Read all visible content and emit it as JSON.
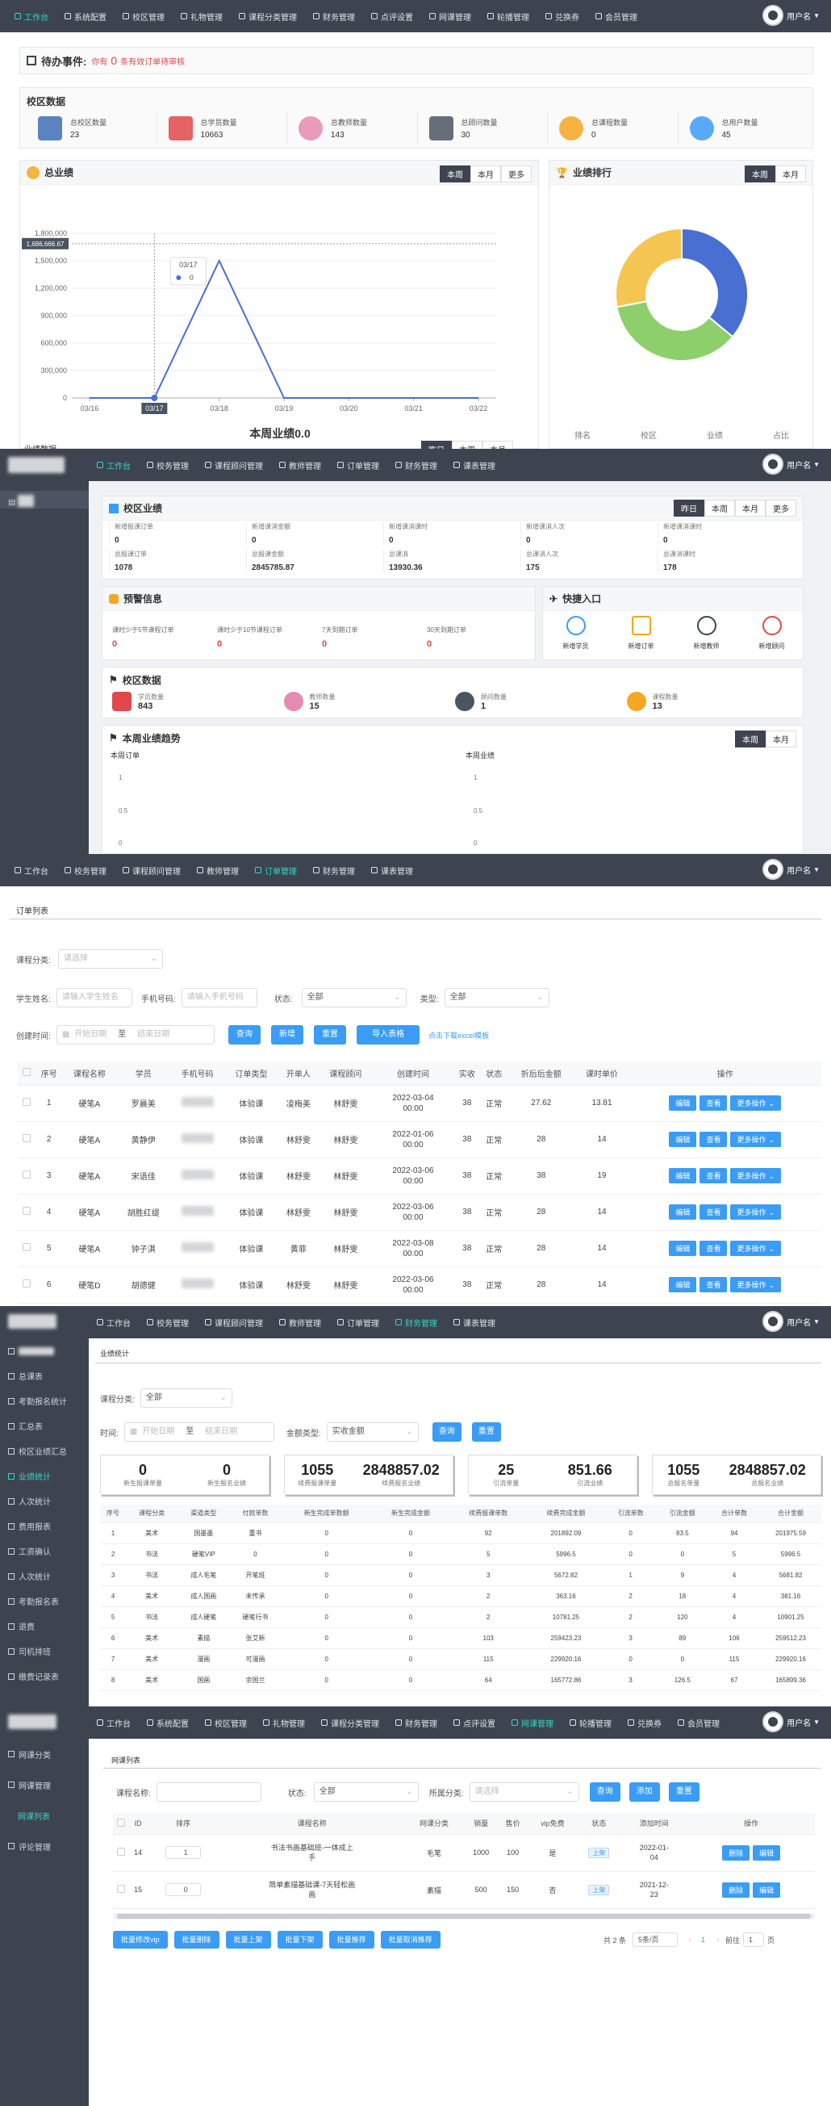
{
  "nav1": {
    "items": [
      "工作台",
      "系统配置",
      "校区管理",
      "礼物管理",
      "课程分类管理",
      "财务管理",
      "点评设置",
      "网课管理",
      "轮播管理",
      "兑换券",
      "会员管理"
    ],
    "active": 0,
    "user": "用户名"
  },
  "panel1": {
    "todo": {
      "title": "待办事件:",
      "prefix": "你有",
      "count": "0",
      "suffix": "条有效订单待审核"
    },
    "campus": {
      "title": "校区数据",
      "stats": [
        {
          "label": "总校区数量",
          "value": "23"
        },
        {
          "label": "总学员数量",
          "value": "10663"
        },
        {
          "label": "总教师数量",
          "value": "143"
        },
        {
          "label": "总顾问数量",
          "value": "30"
        },
        {
          "label": "总课程数量",
          "value": "0"
        },
        {
          "label": "总用户数量",
          "value": "45"
        }
      ]
    },
    "perf": {
      "title": "总业绩",
      "tabs": [
        "本周",
        "本月",
        "更多"
      ],
      "active": 0,
      "bottom_title": "本周业绩0.0",
      "tooltip_date": "03/17",
      "tooltip_value": "0",
      "hover_label": "1,686,666.67",
      "footer_left": "业绩数据",
      "footer_tabs": [
        "昨日",
        "本周",
        "本月"
      ]
    },
    "rank": {
      "title": "业绩排行",
      "tabs": [
        "本周",
        "本月"
      ],
      "active": 0,
      "cols": [
        "排名",
        "校区",
        "业绩",
        "占比"
      ]
    }
  },
  "chart_data": [
    {
      "type": "line",
      "title": "",
      "x": [
        "03/16",
        "03/17",
        "03/18",
        "03/19",
        "03/20",
        "03/21",
        "03/22"
      ],
      "values": [
        0,
        0,
        1500000,
        0,
        0,
        0,
        0
      ],
      "ylim": [
        0,
        1800000
      ],
      "yticks": [
        "0",
        "300,000",
        "600,000",
        "900,000",
        "1,200,000",
        "1,500,000",
        "1,800,000"
      ],
      "color": "#4a6fd2"
    },
    {
      "type": "pie",
      "values": [
        36,
        36,
        28
      ],
      "colors": [
        "#4a6fd2",
        "#8dd06b",
        "#f5c552"
      ]
    }
  ],
  "nav2": {
    "items": [
      "工作台",
      "校务管理",
      "课程顾问管理",
      "教师管理",
      "订单管理",
      "财务管理",
      "课表管理"
    ],
    "active": 0,
    "user": "用户名"
  },
  "panel2": {
    "side_item": "学生",
    "campus_perf": {
      "title": "校区业绩",
      "tabs": [
        "昨日",
        "本周",
        "本月",
        "更多"
      ],
      "active": 0,
      "row1": [
        {
          "label": "新增报课订单",
          "value": "0"
        },
        {
          "label": "新增课消金额",
          "value": "0"
        },
        {
          "label": "新增课消课时",
          "value": "0"
        },
        {
          "label": "新增课消人次",
          "value": "0"
        },
        {
          "label": "新增课消课时",
          "value": "0"
        }
      ],
      "row2": [
        {
          "label": "总报课订单",
          "value": "1078"
        },
        {
          "label": "总报课金额",
          "value": "2845785.87"
        },
        {
          "label": "总课消",
          "value": "13930.36"
        },
        {
          "label": "总课消人次",
          "value": "175"
        },
        {
          "label": "总课消课时",
          "value": "178"
        }
      ]
    },
    "warn": {
      "title": "预警信息",
      "items": [
        {
          "label": "课时少于5节课程订单",
          "value": "0"
        },
        {
          "label": "课时少于10节课程订单",
          "value": "0"
        },
        {
          "label": "7天到期订单",
          "value": "0"
        },
        {
          "label": "30天到期订单",
          "value": "0"
        }
      ]
    },
    "quick": {
      "title": "快捷入口",
      "items": [
        "新增学员",
        "新增订单",
        "新增教师",
        "新增顾问"
      ]
    },
    "cdata": {
      "title": "校区数据",
      "items": [
        {
          "label": "学员数量",
          "value": "843"
        },
        {
          "label": "教师数量",
          "value": "15"
        },
        {
          "label": "顾问数量",
          "value": "1"
        },
        {
          "label": "课程数量",
          "value": "13"
        }
      ]
    },
    "trend": {
      "title": "本周业绩趋势",
      "tabs": [
        "本周",
        "本月"
      ],
      "left": "本周订单",
      "right": "本周业绩",
      "ticks": [
        "1",
        "0.5",
        "0"
      ]
    }
  },
  "nav3": {
    "items": [
      "工作台",
      "校务管理",
      "课程顾问管理",
      "教师管理",
      "订单管理",
      "财务管理",
      "课表管理"
    ],
    "active": 4,
    "user": "用户名"
  },
  "panel3": {
    "title": "订单列表",
    "filters": {
      "category_label": "课程分类:",
      "category_ph": "请选择",
      "name_label": "学生姓名:",
      "name_ph": "请输入学生姓名",
      "phone_label": "手机号码:",
      "phone_ph": "请输入手机号码",
      "status_label": "状态:",
      "status_val": "全部",
      "type_label": "类型:",
      "type_val": "全部",
      "time_label": "创建时间:",
      "start_ph": "开始日期",
      "to": "至",
      "end_ph": "结束日期"
    },
    "buttons": {
      "query": "查询",
      "add": "新增",
      "reset": "重置",
      "import": "导入表格",
      "download": "点击下载excel模板"
    },
    "cols": [
      "序号",
      "课程名称",
      "学员",
      "手机号码",
      "订单类型",
      "开单人",
      "课程顾问",
      "创建时间",
      "实收",
      "状态",
      "折后后金额",
      "课时单价",
      "操作"
    ],
    "rows": [
      [
        "1",
        "硬笔A",
        "罗晨美",
        "",
        "体验课",
        "凌梅美",
        "林舒雯",
        "2022-03-04 00:00",
        "38",
        "正常",
        "27.62",
        "13.81"
      ],
      [
        "2",
        "硬笔A",
        "黄静伊",
        "",
        "体验课",
        "林舒雯",
        "林舒雯",
        "2022-01-06 00:00",
        "38",
        "正常",
        "28",
        "14"
      ],
      [
        "3",
        "硬笔A",
        "宋语佳",
        "",
        "体验课",
        "林舒雯",
        "林舒雯",
        "2022-03-06 00:00",
        "38",
        "正常",
        "38",
        "19"
      ],
      [
        "4",
        "硬笔A",
        "胡胜红缇",
        "",
        "体验课",
        "林舒雯",
        "林舒雯",
        "2022-03-06 00:00",
        "38",
        "正常",
        "28",
        "14"
      ],
      [
        "5",
        "硬笔A",
        "钟子淇",
        "",
        "体验课",
        "黄菲",
        "林舒雯",
        "2022-03-08 00:00",
        "38",
        "正常",
        "28",
        "14"
      ],
      [
        "6",
        "硬笔D",
        "胡德健",
        "",
        "体验课",
        "林舒雯",
        "林舒雯",
        "2022-03-06 00:00",
        "38",
        "正常",
        "28",
        "14"
      ]
    ],
    "ops": [
      "编辑",
      "查看",
      "更多操作"
    ]
  },
  "nav4": {
    "items": [
      "工作台",
      "校务管理",
      "课程顾问管理",
      "教师管理",
      "订单管理",
      "财务管理",
      "课表管理"
    ],
    "active": 5,
    "user": "用户名"
  },
  "panel4": {
    "side": [
      "",
      "总课表",
      "考勤报名统计",
      "汇总表",
      "校区业绩汇总",
      "",
      "人次统计",
      "费用报表",
      "工资确认",
      "人次统计",
      "考勤报名表",
      "退费",
      "司机排班",
      "缴费记录表"
    ],
    "side_active": 5,
    "side_active_label": "业绩统计",
    "title": "业绩统计",
    "filters": {
      "category_label": "课程分类:",
      "category_val": "全部",
      "time_label": "时间:",
      "start_ph": "开始日期",
      "to": "至",
      "end_ph": "结束日期",
      "type_label": "金额类型:",
      "type_val": "实收金额",
      "query": "查询",
      "reset": "重置"
    },
    "summary": [
      {
        "v1": "0",
        "l1": "新生报课单量",
        "v2": "0",
        "l2": "新生报名业绩"
      },
      {
        "v1": "1055",
        "l1": "续费报课单量",
        "v2": "2848857.02",
        "l2": "续费报名业绩"
      },
      {
        "v1": "25",
        "l1": "引流单量",
        "v2": "851.66",
        "l2": "引流业绩"
      },
      {
        "v1": "1055",
        "l1": "总报名单量",
        "v2": "2848857.02",
        "l2": "总报名业绩"
      }
    ],
    "cols": [
      "序号",
      "课程分类",
      "渠道类型",
      "付款单数",
      "新生完成单数额",
      "新生完成金额",
      "续费报课单数",
      "续费完成金额",
      "引流单数",
      "引流金额",
      "合计单数",
      "合计金额"
    ],
    "rows": [
      [
        "1",
        "美术",
        "国墨墨",
        "重书",
        "0",
        "0",
        "92",
        "201892.09",
        "0",
        "83.5",
        "94",
        "201975.59"
      ],
      [
        "2",
        "书法",
        "硬笔VIP",
        "0",
        "0",
        "0",
        "5",
        "5996.5",
        "0",
        "0",
        "5",
        "5996.5"
      ],
      [
        "3",
        "书法",
        "成人毛笔",
        "开笔班",
        "0",
        "0",
        "3",
        "5672.82",
        "1",
        "9",
        "4",
        "5681.82"
      ],
      [
        "4",
        "美术",
        "成人国画",
        "未传承",
        "0",
        "0",
        "2",
        "363.16",
        "2",
        "18",
        "4",
        "381.16"
      ],
      [
        "5",
        "书法",
        "成人硬笔",
        "硬笔行书",
        "0",
        "0",
        "2",
        "10781.25",
        "2",
        "120",
        "4",
        "10901.25"
      ],
      [
        "6",
        "美术",
        "素描",
        "张艾新",
        "0",
        "0",
        "103",
        "259423.23",
        "3",
        "89",
        "106",
        "259512.23"
      ],
      [
        "7",
        "美术",
        "漫画",
        "可漫画",
        "0",
        "0",
        "115",
        "229920.16",
        "0",
        "0",
        "115",
        "229920.16"
      ],
      [
        "8",
        "美术",
        "国画",
        "余国兰",
        "0",
        "0",
        "64",
        "165772.86",
        "3",
        "126.5",
        "67",
        "165899.36"
      ]
    ]
  },
  "nav5": {
    "items": [
      "工作台",
      "系统配置",
      "校区管理",
      "礼物管理",
      "课程分类管理",
      "财务管理",
      "点评设置",
      "网课管理",
      "轮播管理",
      "兑换券",
      "会员管理"
    ],
    "active": 7,
    "user": "用户名"
  },
  "panel5": {
    "side": [
      "网课分类",
      "网课管理",
      "网课列表",
      "评论管理"
    ],
    "side_active": 2,
    "title": "网课列表",
    "filters": {
      "name_label": "课程名称:",
      "status_label": "状态:",
      "status_val": "全部",
      "cat_label": "所属分类:",
      "cat_ph": "请选择",
      "query": "查询",
      "add": "添加",
      "reset": "重置"
    },
    "cols": [
      "",
      "ID",
      "排序",
      "课程名称",
      "网课分类",
      "销量",
      "售价",
      "vip免费",
      "状态",
      "添加时间",
      "操作"
    ],
    "rows": [
      {
        "id": "14",
        "order": "1",
        "name": "书法书画基础班-一体成上手",
        "cat": "毛笔",
        "sales": "1000",
        "price": "100",
        "vip": "是",
        "status": "上架",
        "time": "2022-01-04"
      },
      {
        "id": "15",
        "order": "0",
        "name": "简单素描基础课-7天轻松画画",
        "cat": "素描",
        "sales": "500",
        "price": "150",
        "vip": "否",
        "status": "上架",
        "time": "2021-12-23"
      }
    ],
    "row_ops": [
      "删除",
      "编辑"
    ],
    "bulk": [
      "批量修改vip",
      "批量删除",
      "批量上架",
      "批量下架",
      "批量推荐",
      "批量取消推荐"
    ],
    "pager": {
      "total": "共 2 条",
      "size": "5条/页",
      "page": "1",
      "goto": "前往",
      "goto_val": "1",
      "unit": "页"
    }
  }
}
